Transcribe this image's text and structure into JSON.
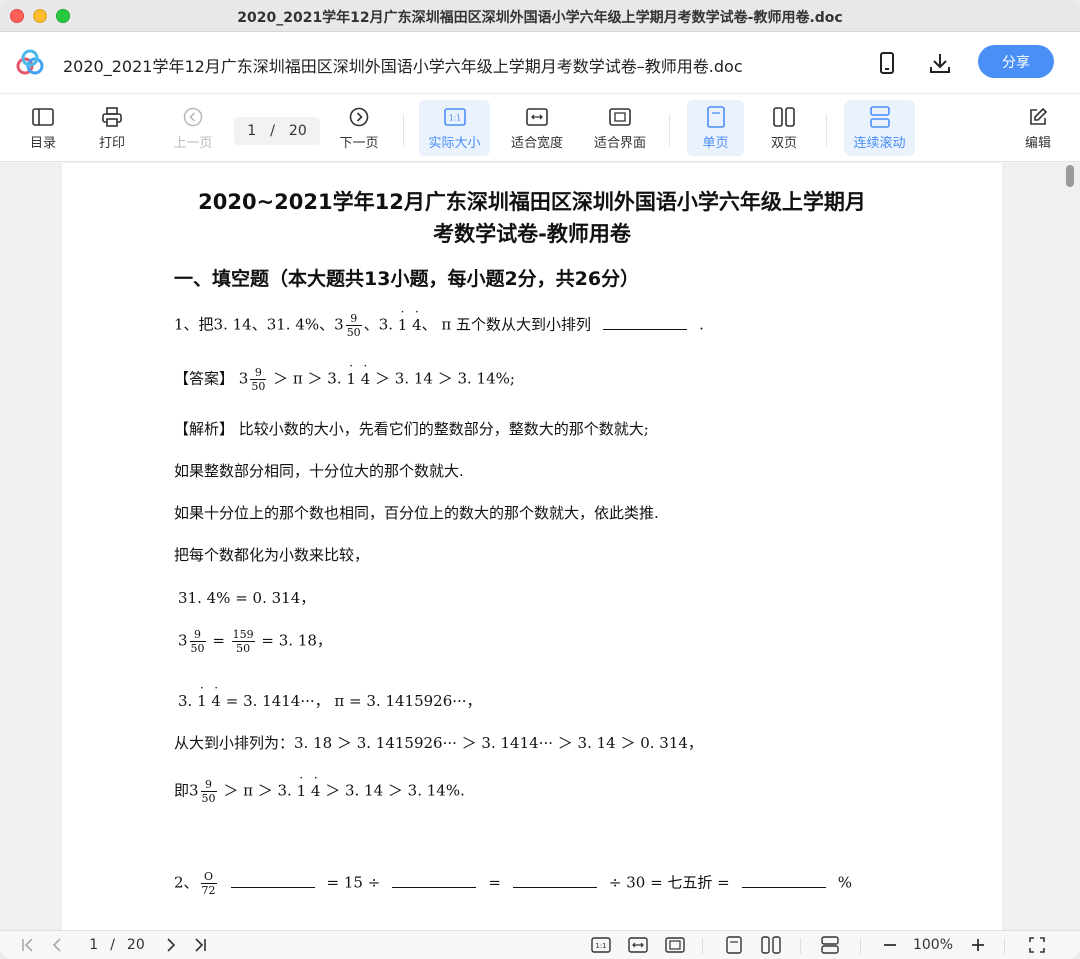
{
  "window": {
    "title": "2020_2021学年12月广东深圳福田区深圳外国语小学六年级上学期月考数学试卷-教师用卷.doc"
  },
  "header": {
    "doc_name": "2020_2021学年12月广东深圳福田区深圳外国语小学六年级上学期月考数学试卷–教师用卷.doc",
    "share_label": "分享",
    "brand_color": "#4a8ff5"
  },
  "toolbar": {
    "toc": "目录",
    "print": "打印",
    "prev": "上一页",
    "current_page": "1",
    "page_sep": "/",
    "total_pages": "20",
    "next": "下一页",
    "actual_size": "实际大小",
    "fit_width": "适合宽度",
    "fit_window": "适合界面",
    "single": "单页",
    "double": "双页",
    "continuous": "连续滚动",
    "edit": "编辑"
  },
  "doc": {
    "title_line1": "2020~2021学年12月广东深圳福田区深圳外国语小学六年级上学期月",
    "title_line2": "考数学试卷-教师用卷",
    "section1": "一、填空题（本大题共13小题，每小题2分，共26分）",
    "q1": {
      "prefix": "1、把3. 14、31. 4%、3",
      "frac_num": "9",
      "frac_den": "50",
      "mid": "、3. ",
      "d1": "1",
      "d2": "4",
      "suffix": "、 π 五个数从大到小排列",
      "end": "."
    },
    "answer": {
      "label": "【答案】",
      "int": "3",
      "frac_num": "9",
      "frac_den": "50",
      "p1": " ＞  π  ＞ 3. ",
      "d1": "1",
      "d2": "4",
      "p2": " ＞ 3. 14 ＞ 3. 14%;"
    },
    "analysis_label": "【解析】",
    "analysis1": "比较小数的大小，先看它们的整数部分，整数大的那个数就大;",
    "analysis2": "如果整数部分相同，十分位大的那个数就大.",
    "analysis3": "如果十分位上的那个数也相同，百分位上的数大的那个数就大，依此类推.",
    "analysis4": "把每个数都化为小数来比较，",
    "calc1": "31. 4% = 0. 314，",
    "calc2": {
      "int": "3",
      "f1_num": "9",
      "f1_den": "50",
      "eq": " = ",
      "f2_num": "159",
      "f2_den": "50",
      "tail": " = 3. 18，"
    },
    "calc3": {
      "head": "3. ",
      "d1": "1",
      "d2": "4",
      "tail": " = 3. 1414···，  π  = 3. 1415926···，"
    },
    "order": "从大到小排列为：3. 18 ＞ 3. 1415926··· ＞ 3. 1414··· ＞ 3. 14 ＞ 0. 314，",
    "final": {
      "head": "即3",
      "frac_num": "9",
      "frac_den": "50",
      "p1": " ＞  π  ＞ 3. ",
      "d1": "1",
      "d2": "4",
      "p2": " ＞ 3. 14 ＞ 3. 14%."
    },
    "q2": {
      "prefix": "2、",
      "frac_num": "O",
      "frac_den": "72",
      "p1": "= 15 ÷",
      "p2": "=",
      "p3": "÷ 30  =  七五折  =",
      "p4": "%"
    }
  },
  "status": {
    "current_page": "1",
    "page_sep": "/",
    "total_pages": "20",
    "zoom": "100%"
  }
}
